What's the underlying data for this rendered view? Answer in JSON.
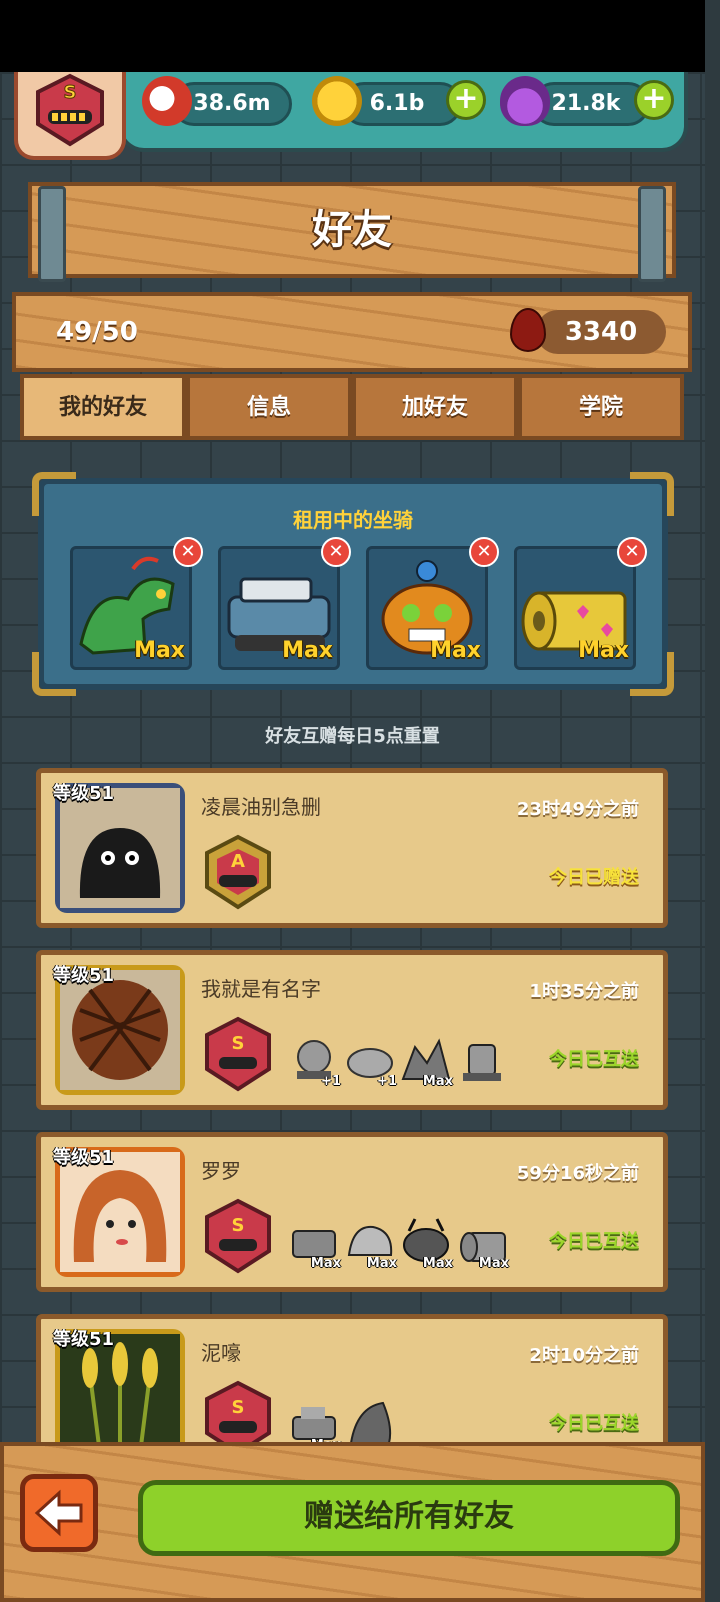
{
  "header": {
    "player_rank": "S",
    "resources": [
      {
        "icon": "eyeball-icon",
        "value": "38.6m",
        "addable": false
      },
      {
        "icon": "gold-coin-icon",
        "value": "6.1b",
        "addable": true
      },
      {
        "icon": "potion-icon",
        "value": "21.8k",
        "addable": true
      }
    ]
  },
  "title": "好友",
  "info": {
    "friend_count": "49/50",
    "blood_value": "3340"
  },
  "tabs": [
    {
      "label": "我的好友",
      "active": true
    },
    {
      "label": "信息",
      "active": false
    },
    {
      "label": "加好友",
      "active": false
    },
    {
      "label": "学院",
      "active": false
    }
  ],
  "rented_mounts": {
    "title": "租用中的坐骑",
    "items": [
      {
        "name": "dragon-mount",
        "badge": "Max",
        "color": "#3fa34a"
      },
      {
        "name": "tank-mount",
        "badge": "Max",
        "color": "#5a8aa8"
      },
      {
        "name": "pumpkin-mount",
        "badge": "Max",
        "color": "#e28a1e"
      },
      {
        "name": "roll-mount",
        "badge": "Max",
        "color": "#e7c83a"
      }
    ]
  },
  "reset_note": "好友互赠每日5点重置",
  "friends": [
    {
      "level": "等级51",
      "name": "凌晨油别急删",
      "time": "23时49分之前",
      "gift": "今日已赠送",
      "gift_type": "sent",
      "rank": "A",
      "portrait_color": "#3a4f7a",
      "mounts": []
    },
    {
      "level": "等级51",
      "name": "我就是有名字",
      "time": "1时35分之前",
      "gift": "今日已互送",
      "gift_type": "mutual",
      "rank": "S",
      "portrait_color": "#c89a1a",
      "mounts": [
        {
          "label": "+1"
        },
        {
          "label": "+1"
        },
        {
          "label": "Max"
        },
        {
          "label": ""
        }
      ]
    },
    {
      "level": "等级51",
      "name": "罗罗",
      "time": "59分16秒之前",
      "gift": "今日已互送",
      "gift_type": "mutual",
      "rank": "S",
      "portrait_color": "#d86a1a",
      "mounts": [
        {
          "label": "Max"
        },
        {
          "label": "Max"
        },
        {
          "label": "Max"
        },
        {
          "label": "Max"
        }
      ]
    },
    {
      "level": "等级51",
      "name": "泥嚎",
      "time": "2时10分之前",
      "gift": "今日已互送",
      "gift_type": "mutual",
      "rank": "S",
      "portrait_color": "#c89a1a",
      "mounts": [
        {
          "label": "Max"
        },
        {
          "label": ""
        }
      ]
    }
  ],
  "footer": {
    "send_all_label": "赠送给所有好友"
  }
}
